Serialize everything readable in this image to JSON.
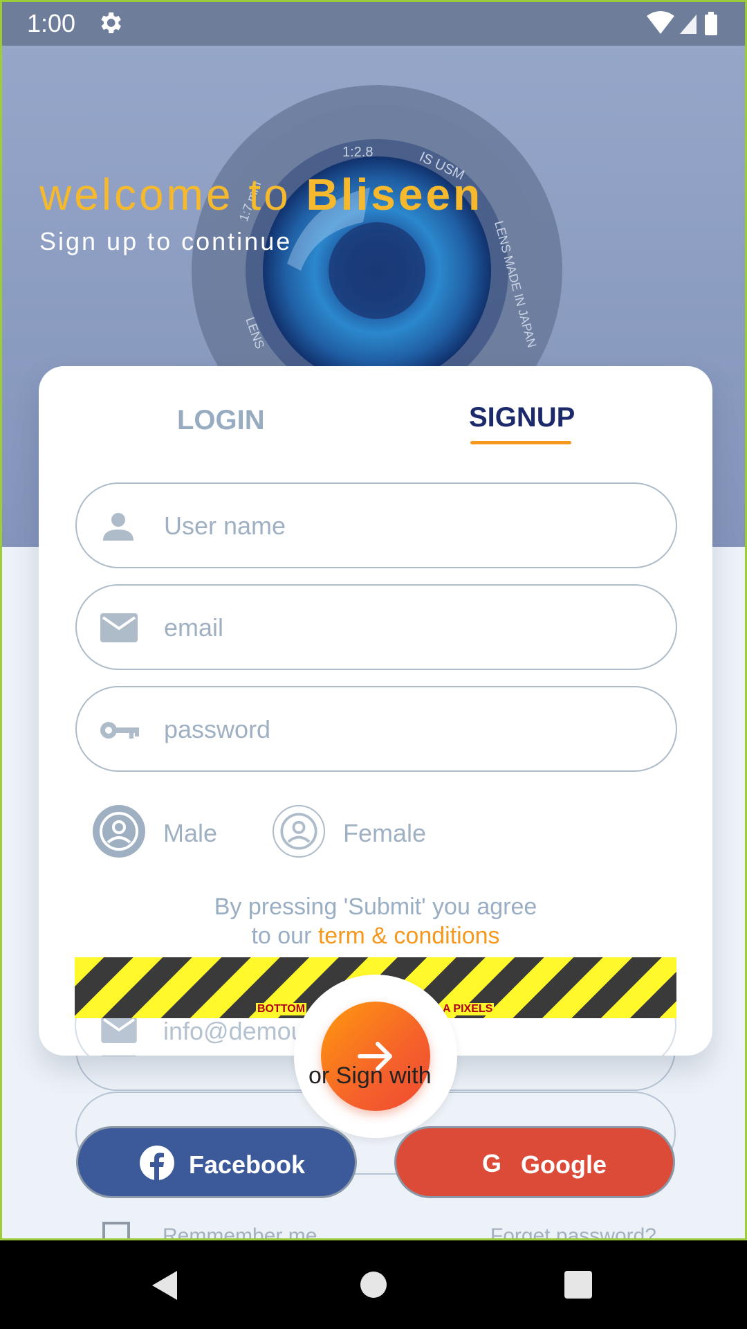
{
  "status_bar": {
    "time": "1:00"
  },
  "hero": {
    "welcome_prefix": "welcome to ",
    "brand": "Bliseen",
    "subtitle": "Sign up to continue",
    "lens_text": [
      "1:2.8",
      "IS USM",
      "LENS MADE IN JAPAN",
      "LENS",
      "1:7 mm"
    ]
  },
  "tabs": {
    "login": "LOGIN",
    "signup": "SIGNUP"
  },
  "form": {
    "username_placeholder": "User name",
    "email_placeholder": "email",
    "password_placeholder": "password",
    "gender_male": "Male",
    "gender_female": "Female",
    "terms_line1": "By pressing 'Submit' you agree",
    "terms_line2_prefix": "to our ",
    "terms_link": "term & conditions"
  },
  "overflow_warning": {
    "left": "BOTTOM",
    "right": "A PIXELS"
  },
  "background_form": {
    "email_value": "info@demou",
    "remember_label": "Remmember me",
    "forget_label": "Forget password?"
  },
  "submit": {
    "or_sign_with": "or Sign with"
  },
  "social": {
    "facebook": "Facebook",
    "google": "Google"
  },
  "colors": {
    "brand_yellow": "#f6b92d",
    "accent_orange": "#f5981d",
    "signup_tab": "#1c2a6c",
    "facebook": "#3c5a9a",
    "google": "#dc4a38"
  }
}
